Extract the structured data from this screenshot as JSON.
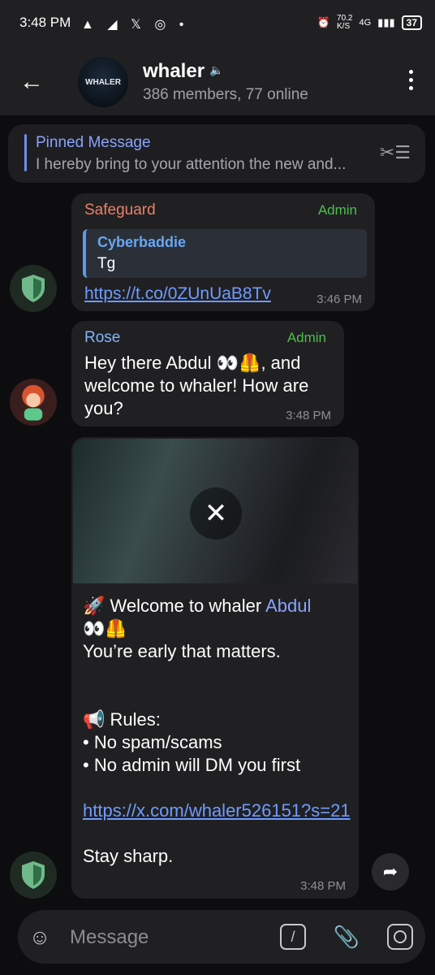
{
  "status_bar": {
    "time": "3:48 PM",
    "notification_icons": "▲ ◢ 𝕏 ◎ •",
    "speed": "70.2\nK/S",
    "network": "4G",
    "battery": "37"
  },
  "header": {
    "title": "whaler",
    "subtitle": "386 members, 77 online",
    "avatar_text": "WHALER"
  },
  "pinned": {
    "title": "Pinned Message",
    "text": "I hereby bring to your attention the new and..."
  },
  "messages": [
    {
      "sender": "Safeguard",
      "role": "Admin",
      "reply_name": "Cyberbaddie",
      "reply_text": "Tg",
      "link": "https://t.co/0ZUnUaB8Tv",
      "time": "3:46 PM"
    },
    {
      "sender": "Rose",
      "role": "Admin",
      "text": "Hey there Abdul 👀🦺, and welcome to whaler! How are you?",
      "time": "3:48 PM"
    },
    {
      "line1_prefix": "🚀 Welcome to whaler ",
      "line1_name": "Abdul",
      "line2": "👀🦺",
      "line3": "You’re early  that matters.",
      "rules_title": "📢 Rules:",
      "rule1": "• No spam/scams",
      "rule2": "• No admin will DM you first",
      "link": "https://x.com/whaler526151?s=21",
      "closing": "Stay sharp.",
      "time": "3:48 PM"
    }
  ],
  "input": {
    "placeholder": "Message"
  },
  "colors": {
    "accent_blue": "#6f9bff",
    "admin_green": "#4cbf4c",
    "safeguard_name": "#e8806a",
    "rose_name": "#7fb6ff"
  }
}
